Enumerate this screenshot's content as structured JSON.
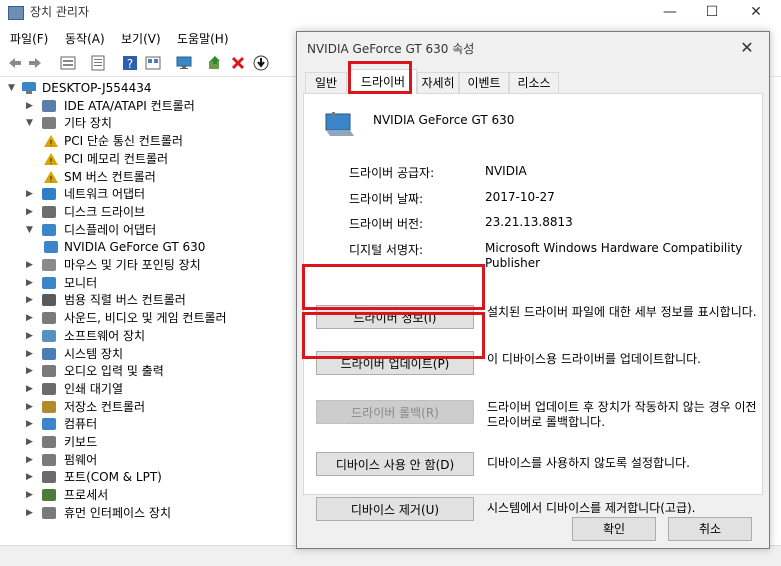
{
  "main_window": {
    "title": "장치 관리자",
    "controls": {
      "minimize": "—",
      "maximize": "☐",
      "close": "✕"
    },
    "menu": [
      "파일(F)",
      "동작(A)",
      "보기(V)",
      "도움말(H)"
    ],
    "toolbar_icons": [
      "back-arrow-icon",
      "forward-arrow-icon",
      "properties-icon",
      "device-list-icon",
      "help-icon",
      "view-icon",
      "monitor-icon",
      "update-driver-icon",
      "uninstall-icon",
      "download-icon"
    ]
  },
  "tree": {
    "root": "DESKTOP-J554434",
    "items": [
      {
        "label": "IDE ATA/ATAPI 컨트롤러",
        "expanded": false,
        "level": 1,
        "icon": "ide-controller-icon",
        "color": "#5b7fa8"
      },
      {
        "label": "기타 장치",
        "expanded": true,
        "level": 1,
        "icon": "other-devices-icon",
        "color": "#7d7d7d"
      },
      {
        "label": "PCI 단순 통신 컨트롤러",
        "level": 2,
        "icon": "warning-device-icon",
        "color": "#d9a400"
      },
      {
        "label": "PCI 메모리 컨트롤러",
        "level": 2,
        "icon": "warning-device-icon",
        "color": "#d9a400"
      },
      {
        "label": "SM 버스 컨트롤러",
        "level": 2,
        "icon": "warning-device-icon",
        "color": "#d9a400"
      },
      {
        "label": "네트워크 어댑터",
        "expanded": false,
        "level": 1,
        "icon": "network-adapter-icon",
        "color": "#2f7fc6"
      },
      {
        "label": "디스크 드라이브",
        "expanded": false,
        "level": 1,
        "icon": "disk-drive-icon",
        "color": "#6d6d6d"
      },
      {
        "label": "디스플레이 어댑터",
        "expanded": true,
        "level": 1,
        "icon": "display-adapter-icon",
        "color": "#3b86c8"
      },
      {
        "label": "NVIDIA GeForce GT 630",
        "level": 2,
        "icon": "display-adapter-icon",
        "color": "#3b86c8"
      },
      {
        "label": "마우스 및 기타 포인팅 장치",
        "expanded": false,
        "level": 1,
        "icon": "mouse-icon",
        "color": "#8a8a8a"
      },
      {
        "label": "모니터",
        "expanded": false,
        "level": 1,
        "icon": "monitor-icon",
        "color": "#3b86c8"
      },
      {
        "label": "범용 직렬 버스 컨트롤러",
        "expanded": false,
        "level": 1,
        "icon": "usb-icon",
        "color": "#5a5a5a"
      },
      {
        "label": "사운드, 비디오 및 게임 컨트롤러",
        "expanded": false,
        "level": 1,
        "icon": "speaker-icon",
        "color": "#7a7a7a"
      },
      {
        "label": "소프트웨어 장치",
        "expanded": false,
        "level": 1,
        "icon": "software-device-icon",
        "color": "#5a8fc2"
      },
      {
        "label": "시스템 장치",
        "expanded": false,
        "level": 1,
        "icon": "system-device-icon",
        "color": "#4a7db5"
      },
      {
        "label": "오디오 입력 및 출력",
        "expanded": false,
        "level": 1,
        "icon": "audio-icon",
        "color": "#7a7a7a"
      },
      {
        "label": "인쇄 대기열",
        "expanded": false,
        "level": 1,
        "icon": "printer-icon",
        "color": "#6b6b6b"
      },
      {
        "label": "저장소 컨트롤러",
        "expanded": false,
        "level": 1,
        "icon": "storage-controller-icon",
        "color": "#b08a2b"
      },
      {
        "label": "컴퓨터",
        "expanded": false,
        "level": 1,
        "icon": "computer-icon",
        "color": "#3b86c8"
      },
      {
        "label": "키보드",
        "expanded": false,
        "level": 1,
        "icon": "keyboard-icon",
        "color": "#7a7a7a"
      },
      {
        "label": "펌웨어",
        "expanded": false,
        "level": 1,
        "icon": "firmware-icon",
        "color": "#7a7a7a"
      },
      {
        "label": "포트(COM & LPT)",
        "expanded": false,
        "level": 1,
        "icon": "port-icon",
        "color": "#6b6b6b"
      },
      {
        "label": "프로세서",
        "expanded": false,
        "level": 1,
        "icon": "processor-icon",
        "color": "#4e7a3a"
      },
      {
        "label": "휴먼 인터페이스 장치",
        "expanded": false,
        "level": 1,
        "icon": "hid-icon",
        "color": "#7a7a7a"
      }
    ]
  },
  "dialog": {
    "title": "NVIDIA GeForce GT 630 속성",
    "close": "✕",
    "tabs": [
      "일반",
      "드라이버",
      "자세히",
      "이벤트",
      "리소스"
    ],
    "active_tab": "드라이버",
    "device_name": "NVIDIA GeForce GT 630",
    "properties": [
      {
        "label": "드라이버 공급자:",
        "value": "NVIDIA"
      },
      {
        "label": "드라이버 날짜:",
        "value": "2017-10-27"
      },
      {
        "label": "드라이버 버전:",
        "value": "23.21.13.8813"
      },
      {
        "label": "디지털 서명자:",
        "value": "Microsoft Windows Hardware Compatibility Publisher"
      }
    ],
    "buttons": [
      {
        "label": "드라이버 정보(I)",
        "desc": "설치된 드라이버 파일에 대한 세부 정보를 표시합니다.",
        "enabled": true,
        "highlighted": true
      },
      {
        "label": "드라이버 업데이트(P)",
        "desc": "이 디바이스용 드라이버를 업데이트합니다.",
        "enabled": true,
        "highlighted": true
      },
      {
        "label": "드라이버 롤백(R)",
        "desc": "드라이버 업데이트 후 장치가 작동하지 않는 경우 이전 드라이버로 롤백합니다.",
        "enabled": false,
        "highlighted": false
      },
      {
        "label": "디바이스 사용 안 함(D)",
        "desc": "디바이스를 사용하지 않도록 설정합니다.",
        "enabled": true,
        "highlighted": false
      },
      {
        "label": "디바이스 제거(U)",
        "desc": "시스템에서 디바이스를 제거합니다(고급).",
        "enabled": true,
        "highlighted": false
      }
    ],
    "ok": "확인",
    "cancel": "취소"
  },
  "colors": {
    "highlight_red": "#d9161e",
    "dialog_bg": "#f0f0f0",
    "button_bg": "#e1e1e1"
  }
}
